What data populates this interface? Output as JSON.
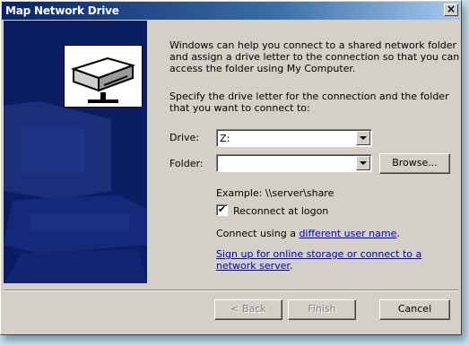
{
  "window": {
    "title": "Map Network Drive",
    "close_glyph": "×"
  },
  "intro": {
    "text": "Windows can help you connect to a shared network folder and assign a drive letter to the connection so that you can access the folder using My Computer."
  },
  "instructions": {
    "text": "Specify the drive letter for the connection and the folder that you want to connect to:"
  },
  "form": {
    "drive_label": "Drive:",
    "drive_value": "Z:",
    "folder_label": "Folder:",
    "folder_value": "",
    "browse_label": "Browse...",
    "example_text": "Example: \\\\server\\share",
    "reconnect_label": "Reconnect at logon",
    "reconnect_checked": true,
    "connect_prefix": "Connect using a ",
    "connect_link": "different user name",
    "connect_suffix": ".",
    "signup_link": "Sign up for online storage or connect to a network server",
    "signup_suffix": "."
  },
  "footer": {
    "back_label": "< Back",
    "finish_label": "Finish",
    "cancel_label": "Cancel"
  },
  "icons": {
    "side_panel": "network-drive-illustration",
    "drive": "network-drive-icon",
    "checkbox_mark": "✔"
  },
  "colors": {
    "titlebar_start": "#0a246a",
    "titlebar_end": "#a6caf0",
    "side_panel": "#0c1e63",
    "dialog_face": "#d4d0c8",
    "link": "#0000cc",
    "background": "#c5e3f2"
  }
}
